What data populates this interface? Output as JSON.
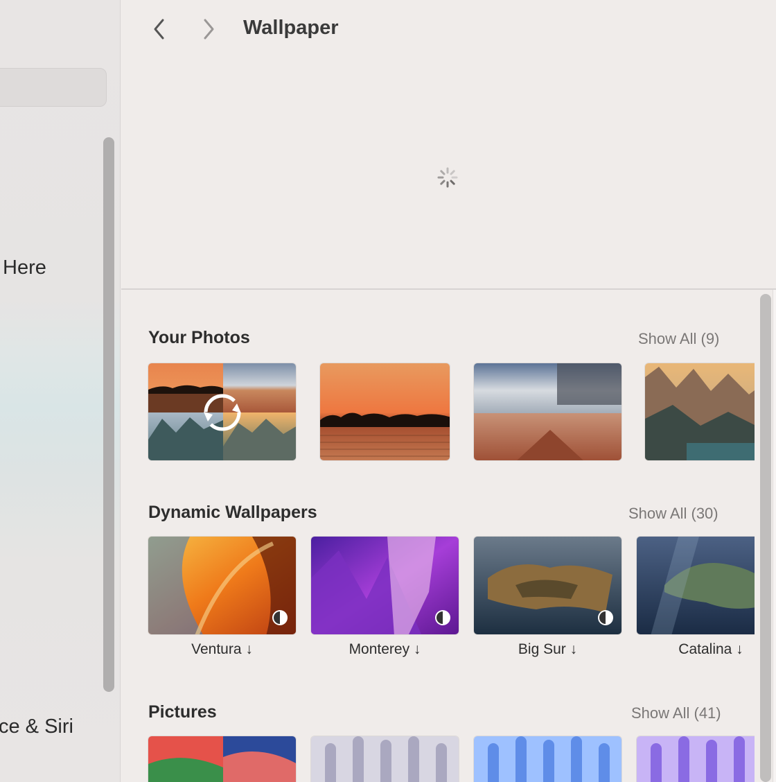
{
  "window": {
    "title": "Wallpaper"
  },
  "sidebar": {
    "items": [
      {
        "label": "Here"
      },
      {
        "label": "ce & Siri"
      }
    ]
  },
  "navigation": {
    "back_icon": "chevron-left-icon",
    "forward_icon": "chevron-right-icon"
  },
  "preview": {
    "state_icon": "loading-spinner-icon"
  },
  "sections": {
    "your_photos": {
      "title": "Your Photos",
      "show_all": "Show All (9)"
    },
    "dynamic": {
      "title": "Dynamic Wallpapers",
      "show_all": "Show All (30)",
      "items": [
        {
          "label": "Ventura ↓"
        },
        {
          "label": "Monterey ↓"
        },
        {
          "label": "Big Sur ↓"
        },
        {
          "label": "Catalina ↓"
        }
      ]
    },
    "pictures": {
      "title": "Pictures",
      "show_all": "Show All (41)"
    }
  },
  "colors": {
    "accent": "#efebea",
    "sidebar": "#e8e5e4",
    "text": "#2d2d2d",
    "muted": "#7a7776"
  }
}
